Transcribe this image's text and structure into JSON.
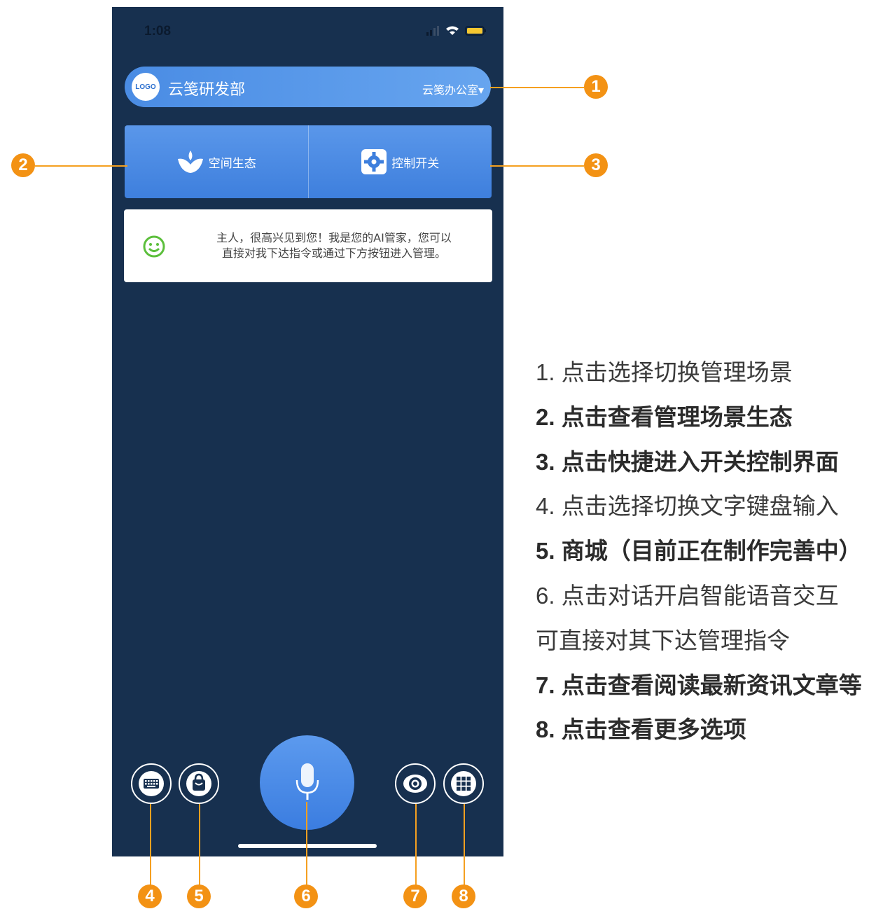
{
  "status_bar": {
    "time": "1:08"
  },
  "header": {
    "logo_text": "LOGO",
    "org_name": "云笺研发部",
    "office_select": "云笺办公室▾"
  },
  "actions": [
    {
      "label": "空间生态",
      "icon": "lotus-icon"
    },
    {
      "label": "控制开关",
      "icon": "gear-icon"
    }
  ],
  "assistant_message": {
    "line1": "主人，很高兴见到您！我是您的AI管家，您可以",
    "line2": "直接对我下达指令或通过下方按钮进入管理。"
  },
  "bottom_buttons": [
    {
      "icon": "keyboard-icon"
    },
    {
      "icon": "shopping-bag-icon"
    },
    {
      "icon": "microphone-icon"
    },
    {
      "icon": "eye-icon"
    },
    {
      "icon": "grid-icon"
    }
  ],
  "callouts": [
    "1",
    "2",
    "3",
    "4",
    "5",
    "6",
    "7",
    "8"
  ],
  "notes": [
    {
      "text": "1. 点击选择切换管理场景",
      "bold": false
    },
    {
      "text": "2. 点击查看管理场景生态",
      "bold": true
    },
    {
      "text": "3. 点击快捷进入开关控制界面",
      "bold": true
    },
    {
      "text": "4. 点击选择切换文字键盘输入",
      "bold": false
    },
    {
      "text": "5. 商城（目前正在制作完善中）",
      "bold": true
    },
    {
      "text": "6. 点击对话开启智能语音交互",
      "bold": false
    },
    {
      "text": "可直接对其下达管理指令",
      "bold": false
    },
    {
      "text": "7. 点击查看阅读最新资讯文章等",
      "bold": true
    },
    {
      "text": "8. 点击查看更多选项",
      "bold": true
    }
  ],
  "colors": {
    "phone_bg": "#17304f",
    "accent_blue": "#4a8ce4",
    "callout_orange": "#f39214"
  }
}
